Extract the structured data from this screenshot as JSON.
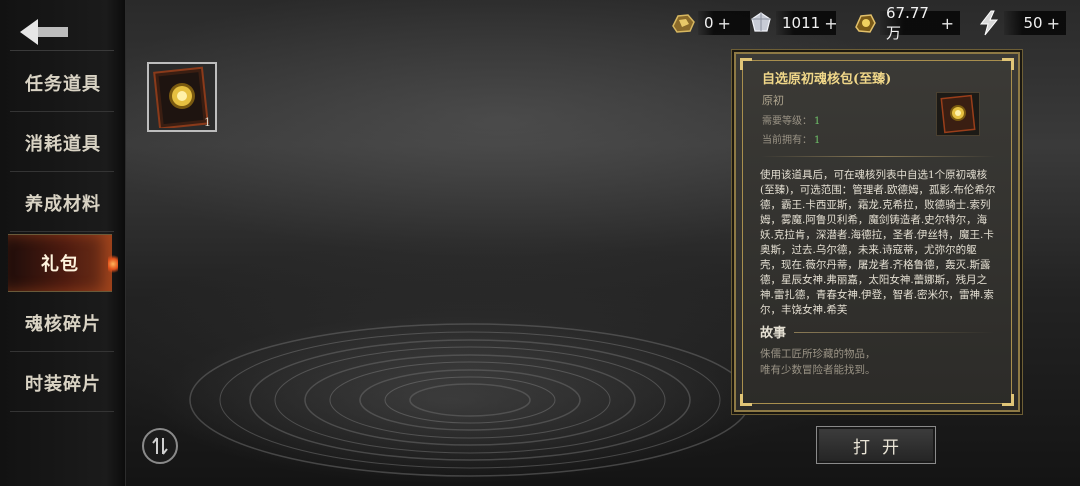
{
  "currencies": [
    {
      "icon": "gold-ore-icon",
      "value": "0",
      "plus": "+"
    },
    {
      "icon": "crystal-icon",
      "value": "1011",
      "plus": "+"
    },
    {
      "icon": "gold-coin-icon",
      "value": "67.77万",
      "plus": "+"
    },
    {
      "icon": "lightning-icon",
      "value": "50",
      "plus": "+"
    }
  ],
  "sidebar": {
    "items": [
      {
        "label": "任务道具",
        "active": false
      },
      {
        "label": "消耗道具",
        "active": false
      },
      {
        "label": "养成材料",
        "active": false
      },
      {
        "label": "礼包",
        "active": true
      },
      {
        "label": "魂核碎片",
        "active": false
      },
      {
        "label": "时装碎片",
        "active": false
      }
    ]
  },
  "inventory": {
    "slots": [
      {
        "icon": "soul-core-pack-icon",
        "count": "1"
      }
    ]
  },
  "detail": {
    "title": "自选原初魂核包(至臻)",
    "type": "原初",
    "level_label": "需要等级：",
    "level_value": "1",
    "owned_label": "当前拥有：",
    "owned_value": "1",
    "description": "使用该道具后，可在魂核列表中自选1个原初魂核(至臻)，可选范围：管理者.欧德姆，孤影.布伦希尔德，霸王.卡西亚斯，霜龙.克希拉，败德骑士.索列姆，雾魔.阿鲁贝利希，魔剑铸造者.史尔特尔，海妖.克拉肯，深潜者.海德拉，圣者.伊丝特，魔王.卡奥斯，过去.乌尔德，未来.诗寇蒂，尤弥尔的躯壳，现在.薇尔丹蒂，屠龙者.齐格鲁德，轰灭.斯露德，星辰女神.弗丽嘉，太阳女神.蕾娜斯，残月之神.雷扎德，青春女神.伊登，智者.密米尔，雷神.索尔，丰饶女神.希芙",
    "story_title": "故事",
    "story_line1": "侏儒工匠所珍藏的物品，",
    "story_line2": "唯有少数冒险者能找到。"
  },
  "open_button": "打开",
  "colors": {
    "title_gold": "#f0d789",
    "value_green": "#6fc36a",
    "frame_gold": "#8e7a45",
    "active_glow": "#e0501a"
  }
}
